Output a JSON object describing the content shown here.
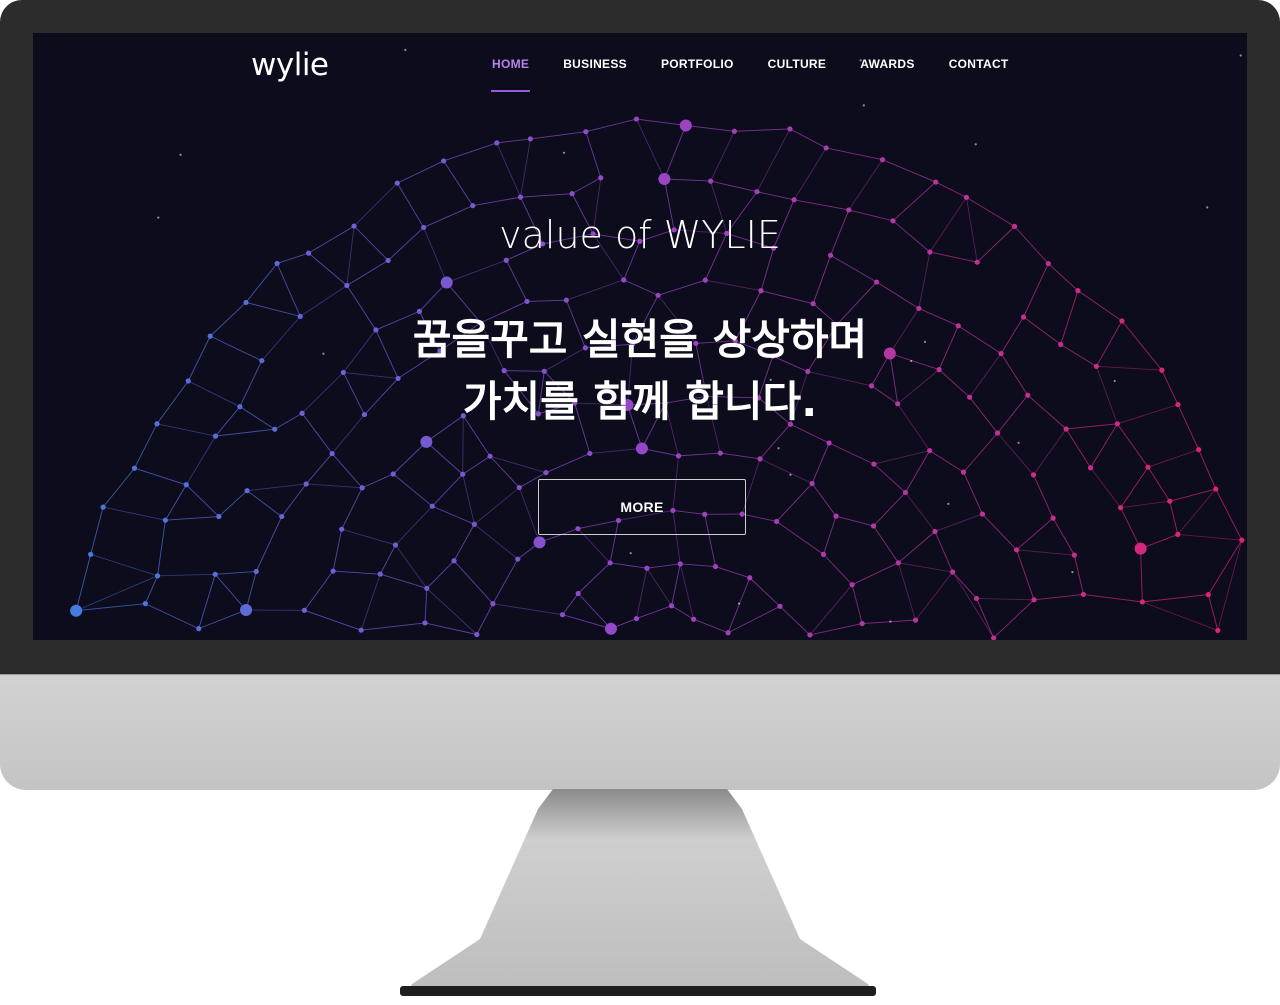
{
  "site": {
    "logo": "wylie",
    "nav": [
      "HOME",
      "BUSINESS",
      "PORTFOLIO",
      "CULTURE",
      "AWARDS",
      "CONTACT"
    ],
    "active_nav": "HOME"
  },
  "hero": {
    "subtitle": "value of WYLIE",
    "title_line1": "꿈을꾸고 실현을 상상하며",
    "title_line2": "가치를 함께 합니다.",
    "button_label": "MORE"
  },
  "colors": {
    "background": "#0c0c1d",
    "accent": "#9a5bd6",
    "network_blue": "#3f7fe0",
    "network_magenta": "#e0226e",
    "monitor_frame": "#2c2c2c",
    "monitor_chin": "#c8c8c8"
  }
}
